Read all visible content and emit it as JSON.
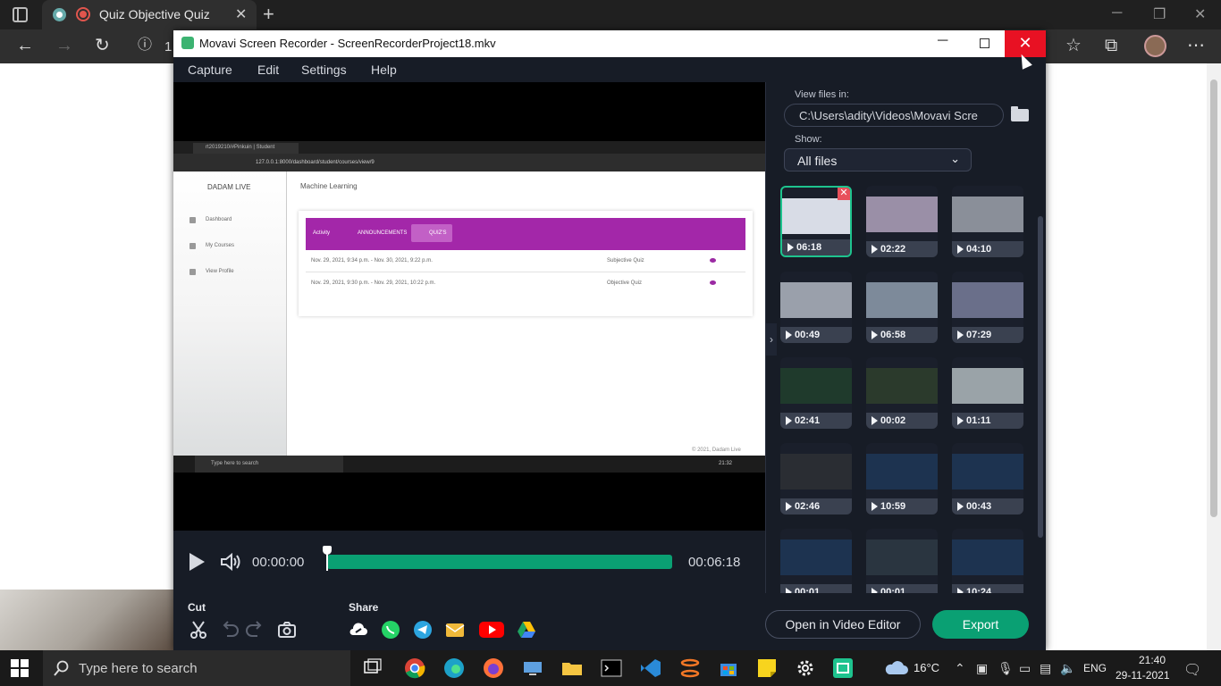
{
  "browser": {
    "tab_title": "Quiz Objective Quiz",
    "new_tab_label": "+",
    "close_tab_label": "✕",
    "url_fragment": "1"
  },
  "movavi": {
    "window_title": "Movavi Screen Recorder - ScreenRecorderProject18.mkv",
    "menu": [
      "Capture",
      "Edit",
      "Settings",
      "Help"
    ],
    "player": {
      "current_time": "00:00:00",
      "total_time": "00:06:18",
      "progress": 0
    },
    "files_panel": {
      "view_files_label": "View files in:",
      "path": "C:\\Users\\adity\\Videos\\Movavi Scre",
      "show_label": "Show:",
      "filter_value": "All files",
      "thumbnails": [
        {
          "duration": "06:18",
          "selected": true
        },
        {
          "duration": "02:22"
        },
        {
          "duration": "04:10"
        },
        {
          "duration": "00:49"
        },
        {
          "duration": "06:58"
        },
        {
          "duration": "07:29"
        },
        {
          "duration": "02:41"
        },
        {
          "duration": "00:02"
        },
        {
          "duration": "01:11"
        },
        {
          "duration": "02:46"
        },
        {
          "duration": "10:59"
        },
        {
          "duration": "00:43"
        },
        {
          "duration": "00:01"
        },
        {
          "duration": "00:01"
        },
        {
          "duration": "10:24"
        }
      ]
    },
    "bottom": {
      "cut_label": "Cut",
      "share_label": "Share",
      "open_editor_label": "Open in Video Editor",
      "export_label": "Export"
    },
    "recorded_frame": {
      "tab_title": "rt2019210/#Pinkuin | Student",
      "url": "127.0.0.1:8000/dashboard/student/courses/view/9",
      "brand": "DADAM LIVE",
      "nav": [
        "Dashboard",
        "My Courses",
        "View Profile"
      ],
      "course_title": "Machine Learning",
      "banner_tabs": [
        "Activity",
        "ANNOUNCEMENTS",
        "QUIZ'S"
      ],
      "rows": [
        {
          "dates": "Nov. 29, 2021, 9:34 p.m. - Nov. 30, 2021, 9:22 p.m.",
          "type": "Subjective Quiz"
        },
        {
          "dates": "Nov. 29, 2021, 9:30 p.m. - Nov. 29, 2021, 10:22 p.m.",
          "type": "Objective Quiz"
        }
      ],
      "footer": "© 2021, Dadam Live",
      "taskbar_search": "Type here to search",
      "clock": "21:32"
    }
  },
  "taskbar": {
    "search_placeholder": "Type here to search",
    "weather": "16°C",
    "language": "ENG",
    "time": "21:40",
    "date": "29-11-2021"
  }
}
